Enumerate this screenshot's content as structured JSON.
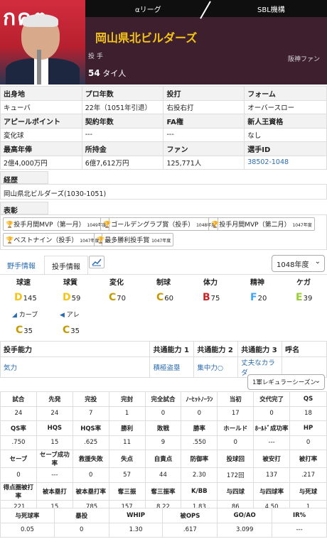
{
  "header": {
    "photo_text": "กคต",
    "tab_league": "αリーグ",
    "tab_org": "SBL機構",
    "team": "岡山県北ビルダーズ",
    "position": "投 手",
    "fan": "阪神ファン",
    "number": "54",
    "player_name": "タイ人"
  },
  "info": {
    "row1_heads": [
      "出身地",
      "プロ年数",
      "投打",
      "フォーム"
    ],
    "row1_vals": [
      "キューバ",
      "22年（1051年引退）",
      "右投右打",
      "オーバースロー"
    ],
    "row2_heads": [
      "アピールポイント",
      "契約年数",
      "FA権",
      "新人王資格"
    ],
    "row2_vals": [
      "変化球",
      "---",
      "---",
      "なし"
    ],
    "row3_heads": [
      "最高年俸",
      "所持金",
      "ファン",
      "選手ID"
    ],
    "row3_vals": [
      "2億4,000万円",
      "6億7,612万円",
      "125,771人",
      "38502-1048"
    ]
  },
  "career": {
    "heading": "経歴",
    "value": "岡山県北ビルダーズ(1030-1051)"
  },
  "awards": {
    "heading": "表彰",
    "items": [
      {
        "name": "投手月間MVP（第一月）",
        "year": "1049年度"
      },
      {
        "name": "ゴールデングラブ賞（投手）",
        "year": "1048年度"
      },
      {
        "name": "投手月間MVP（第二月）",
        "year": "1047年度"
      },
      {
        "name": "ベストナイン（投手）",
        "year": "1047年度"
      },
      {
        "name": "最多勝利投手賞",
        "year": "1047年度"
      }
    ]
  },
  "tabs": {
    "fielder": "野手情報",
    "pitcher": "投手情報",
    "year_select": "1048年度"
  },
  "abilities": {
    "heads": [
      "球速",
      "球質",
      "変化",
      "制球",
      "体力",
      "精神",
      "ケガ"
    ],
    "vals": [
      {
        "g": "D",
        "n": "145",
        "c": "ad"
      },
      {
        "g": "D",
        "n": "59",
        "c": "ad"
      },
      {
        "g": "C",
        "n": "70",
        "c": "ac"
      },
      {
        "g": "C",
        "n": "60",
        "c": "ac"
      },
      {
        "g": "B",
        "n": "75",
        "c": "ab"
      },
      {
        "g": "F",
        "n": "20",
        "c": "af"
      },
      {
        "g": "E",
        "n": "39",
        "c": "ae"
      }
    ],
    "special": [
      {
        "name": "カーブ",
        "g": "C",
        "n": "35"
      },
      {
        "name": "アレ",
        "g": "C",
        "n": "35"
      }
    ]
  },
  "ability_grid": {
    "heads": [
      "投手能力",
      "共通能力 1",
      "共通能力 2",
      "共通能力 3",
      "呼名"
    ],
    "vals": [
      "気力",
      "積極盗塁",
      "集中力○",
      "丈夫なカラダ",
      ""
    ]
  },
  "season_select": "1軍レギュラーシーズン",
  "stats": [
    {
      "h": [
        "試合",
        "先発",
        "完投",
        "完封",
        "完全試合",
        "ﾉｰﾋｯﾄﾉｰﾗﾝ",
        "当初",
        "交代完了",
        "QS"
      ],
      "v": [
        "24",
        "24",
        "7",
        "1",
        "0",
        "0",
        "17",
        "0",
        "18"
      ]
    },
    {
      "h": [
        "QS率",
        "HQS",
        "HQS率",
        "勝利",
        "敗戦",
        "勝率",
        "ホールド",
        "ﾎｰﾙﾄﾞ成功率",
        "HP"
      ],
      "v": [
        ".750",
        "15",
        ".625",
        "11",
        "9",
        ".550",
        "0",
        "---",
        "0"
      ]
    },
    {
      "h": [
        "セーブ",
        "セーブ成功率",
        "救援失敗",
        "失点",
        "自責点",
        "防御率",
        "投球回",
        "被安打",
        "被打率"
      ],
      "v": [
        "0",
        "---",
        "0",
        "57",
        "44",
        "2.30",
        "172回",
        "137",
        ".217"
      ]
    },
    {
      "h": [
        "得点圏被打率",
        "被本塁打",
        "被本塁打率",
        "奪三振",
        "奪三振率",
        "K/BB",
        "与四球",
        "与四球率",
        "与死球"
      ],
      "v": [
        ".221",
        "15",
        ".785",
        "157",
        "8.22",
        "1.83",
        "86",
        "4.50",
        "1"
      ]
    },
    {
      "h": [
        "与死球率",
        "暴投",
        "WHIP",
        "被OPS",
        "GO/AO",
        "IR%"
      ],
      "v": [
        "0.05",
        "0",
        "1.30",
        ".617",
        "3.099",
        "---"
      ]
    }
  ]
}
